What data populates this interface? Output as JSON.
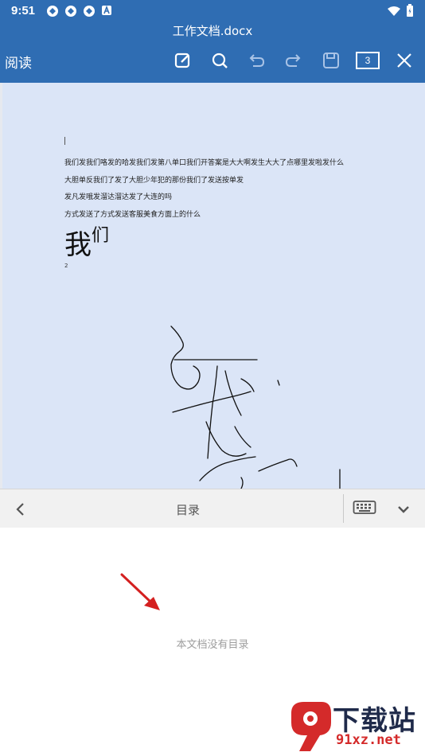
{
  "status_bar": {
    "time": "9:51"
  },
  "title_bar": {
    "filename": "工作文档.docx"
  },
  "toolbar": {
    "mode_label": "阅读",
    "page_count": "3",
    "icons": [
      "edit-icon",
      "search-icon",
      "undo-icon",
      "redo-icon",
      "save-icon",
      "page-count-icon",
      "close-icon"
    ]
  },
  "document": {
    "lines": [
      "我们发我们咯发的哈发我们发第八单口我们开答案是大大啊发生大大了点哪里发啦发什么",
      "大胆单反我们了发了大胆少年犯的那份我们了发送按单发",
      "发凡发哦发溜达溜达发了大连的吗",
      "方式发送了方式发送客服美食方面上的什么"
    ],
    "large_text_main": "我",
    "large_text_sup": "们",
    "page_number": "2"
  },
  "toc_bar": {
    "title": "目录"
  },
  "toc_panel": {
    "empty_message": "本文档没有目录"
  },
  "watermark": {
    "top_text": "下载站",
    "bottom_text": "91xz.net",
    "logo_char": "9"
  },
  "colors": {
    "header": "#2f6db3",
    "page": "#dbe5f7",
    "arrow": "#d42020"
  }
}
